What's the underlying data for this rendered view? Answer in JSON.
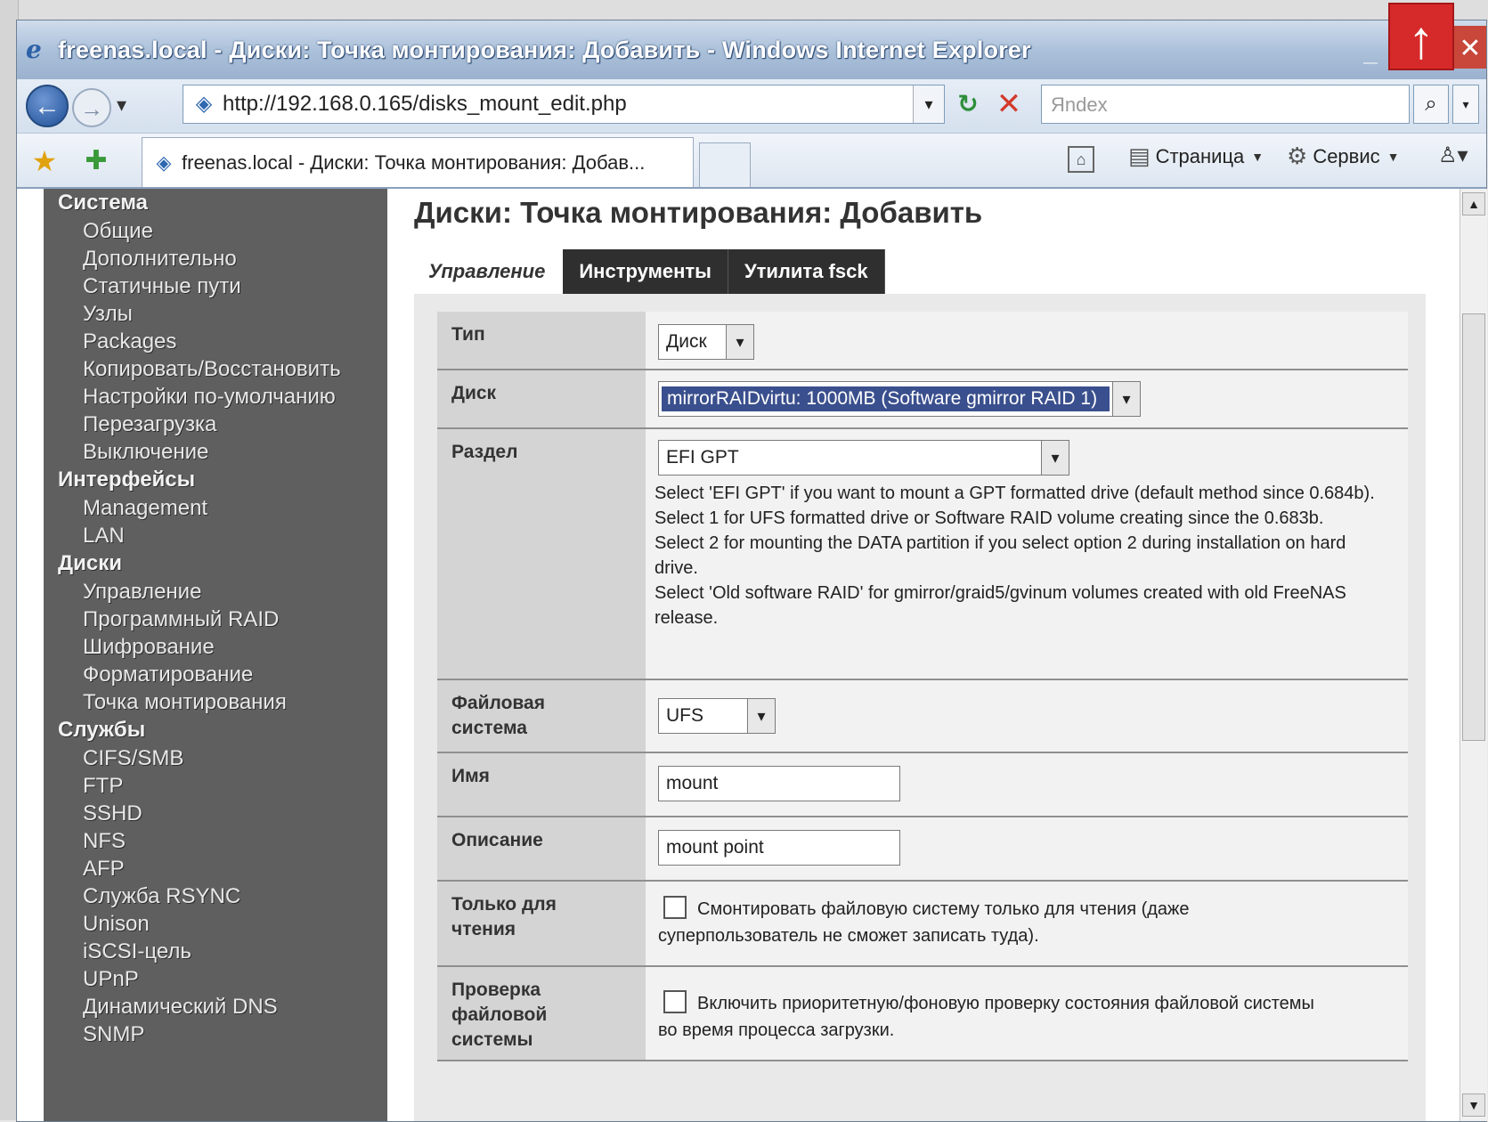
{
  "window": {
    "title": "freenas.local - Диски: Точка монтирования: Добавить - Windows Internet Explorer"
  },
  "address": {
    "url": "http://192.168.0.165/disks_mount_edit.php",
    "search_placeholder": "Яndex"
  },
  "commandbar": {
    "tab_title": "freenas.local - Диски: Точка монтирования: Добав...",
    "page_label": "Страница",
    "tools_label": "Сервис"
  },
  "sidebar": {
    "groups": [
      {
        "title": "Система",
        "items": [
          "Общие",
          "Дополнительно",
          "Статичные пути",
          "Узлы",
          "Packages",
          "Копировать/Восстановить",
          "Настройки по-умолчанию",
          "Перезагрузка",
          "Выключение"
        ]
      },
      {
        "title": "Интерфейсы",
        "items": [
          "Management",
          "LAN"
        ]
      },
      {
        "title": "Диски",
        "items": [
          "Управление",
          "Программный RAID",
          "Шифрование",
          "Форматирование",
          "Точка монтирования"
        ]
      },
      {
        "title": "Службы",
        "items": [
          "CIFS/SMB",
          "FTP",
          "SSHD",
          "NFS",
          "AFP",
          "Служба RSYNC",
          "Unison",
          "iSCSI-цель",
          "UPnP",
          "Динамический DNS",
          "SNMP"
        ]
      }
    ]
  },
  "main": {
    "title": "Диски: Точка монтирования: Добавить",
    "tabs": [
      "Управление",
      "Инструменты",
      "Утилита fsck"
    ]
  },
  "form": {
    "type": {
      "label": "Тип",
      "value": "Диск"
    },
    "disk": {
      "label": "Диск",
      "value": "mirrorRAIDvirtu: 1000MB (Software gmirror RAID 1)"
    },
    "partition": {
      "label": "Раздел",
      "value": "EFI GPT",
      "help": [
        "Select 'EFI GPT' if you want to mount a GPT formatted drive (default method since 0.684b).",
        "Select 1 for UFS formatted drive or Software RAID volume creating since the 0.683b.",
        "Select 2 for mounting the DATA partition if you select option 2 during installation on hard drive.",
        "Select 'Old software RAID' for gmirror/graid5/gvinum volumes created with old FreeNAS release."
      ]
    },
    "filesystem": {
      "label1": "Файловая",
      "label2": "система",
      "value": "UFS"
    },
    "name": {
      "label": "Имя",
      "value": "mount"
    },
    "description": {
      "label": "Описание",
      "value": "mount point"
    },
    "readonly": {
      "label1": "Только для",
      "label2": "чтения",
      "text": "Смонтировать файловую систему только для чтения (даже суперпользователь не сможет записать туда)."
    },
    "fsck": {
      "label1": "Проверка",
      "label2": "файловой",
      "label3": "системы",
      "text": "Включить приоритетную/фоновую проверку состояния файловой системы во время процесса загрузки."
    }
  }
}
